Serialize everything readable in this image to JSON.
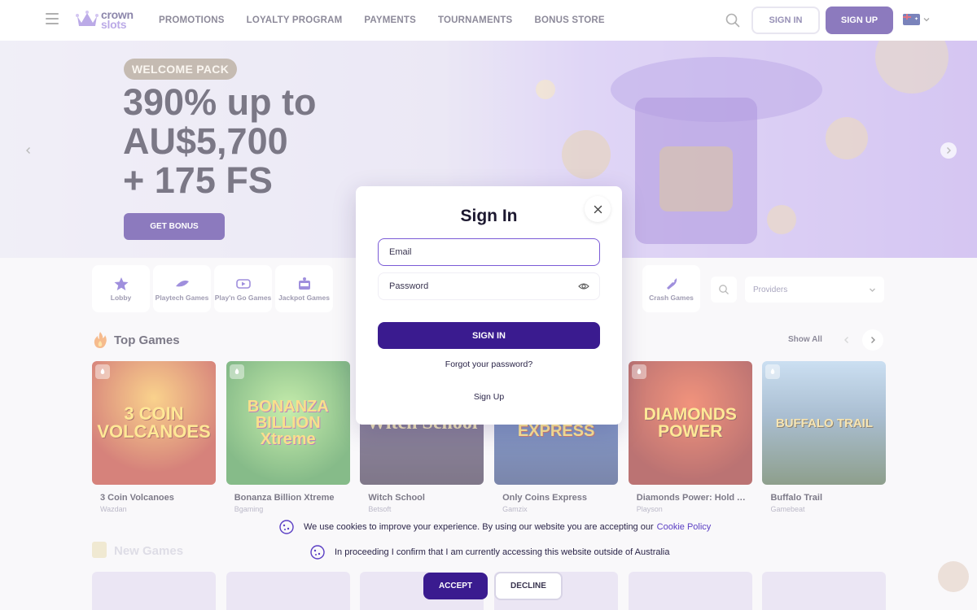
{
  "header": {
    "logo_line1": "crown",
    "logo_line2": "slots",
    "nav": [
      "PROMOTIONS",
      "LOYALTY PROGRAM",
      "PAYMENTS",
      "TOURNAMENTS",
      "BONUS STORE"
    ],
    "sign_in": "SIGN IN",
    "sign_up": "SIGN UP",
    "language_flag": "australia-flag"
  },
  "hero": {
    "pill": "WELCOME PACK",
    "title_line1": "390% up to",
    "title_line2": "AU$5,700",
    "title_line3": "+ 175 FS",
    "cta": "GET BONUS"
  },
  "categories": [
    {
      "label": "Lobby",
      "icon": "star-icon"
    },
    {
      "label": "Playtech Games",
      "icon": "playtech-icon"
    },
    {
      "label": "Play'n Go Games",
      "icon": "playngo-icon"
    },
    {
      "label": "Jackpot Games",
      "icon": "jackpot-icon"
    }
  ],
  "crash_category": {
    "label": "Crash Games",
    "icon": "rocket-icon"
  },
  "providers_placeholder": "Providers",
  "top_games": {
    "title": "Top Games",
    "show_all": "Show All",
    "games": [
      {
        "name": "3 Coin Volcanoes",
        "provider": "Wazdan",
        "art": "3 COIN VOLCANOES",
        "bg": "#b8281c"
      },
      {
        "name": "Bonanza Billion Xtreme",
        "provider": "Bgaming",
        "art": "BONANZA BILLION Xtreme",
        "bg": "#4aa13a"
      },
      {
        "name": "Witch School",
        "provider": "Betsoft",
        "art": "Witch School",
        "bg": "#3b2a5c"
      },
      {
        "name": "Only Coins Express",
        "provider": "Gamzix",
        "art": "ONLY COINS EXPRESS",
        "bg": "#2a4b9a"
      },
      {
        "name": "Diamonds Power: Hold A...",
        "provider": "Playson",
        "art": "DIAMONDS POWER",
        "bg": "#b01a1a"
      },
      {
        "name": "Buffalo Trail",
        "provider": "Gamebeat",
        "art": "BUFFALO TRAIL",
        "bg": "#5d86a8"
      }
    ]
  },
  "new_games": {
    "title": "New Games"
  },
  "modal": {
    "title": "Sign In",
    "email_placeholder": "Email",
    "password_placeholder": "Password",
    "submit": "SIGN IN",
    "forgot": "Forgot your password?",
    "signup": "Sign Up"
  },
  "cookie": {
    "line1": "We use cookies to improve your experience. By using our website you are accepting our",
    "policy_link": "Cookie Policy",
    "line2": "In proceeding I confirm that I am currently accessing this website outside of Australia",
    "accept": "ACCEPT",
    "decline": "DECLINE"
  },
  "colors": {
    "brand": "#3a1b8f",
    "accent": "#7b5bd6"
  }
}
